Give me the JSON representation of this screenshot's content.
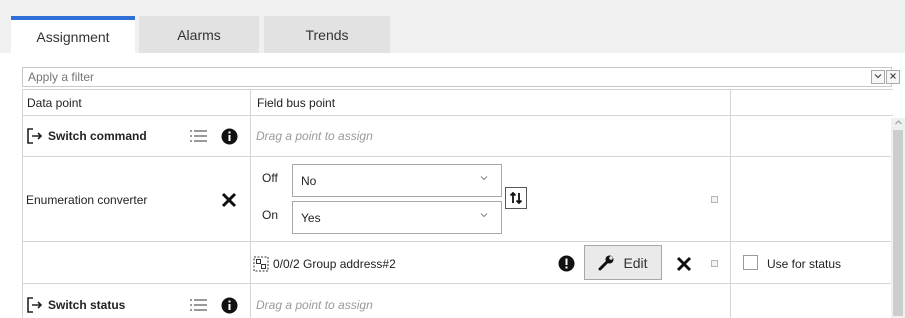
{
  "tabs": [
    {
      "label": "Assignment",
      "active": true
    },
    {
      "label": "Alarms",
      "active": false
    },
    {
      "label": "Trends",
      "active": false
    }
  ],
  "filter": {
    "placeholder": "Apply a filter"
  },
  "table": {
    "headers": {
      "data_point": "Data point",
      "field_bus_point": "Field bus point",
      "extra": ""
    },
    "rows": {
      "switch_command": {
        "label": "Switch command",
        "assign_hint": "Drag a point to assign"
      },
      "enumeration_converter": {
        "label": "Enumeration converter",
        "off_label": "Off",
        "off_value": "No",
        "on_label": "On",
        "on_value": "Yes"
      },
      "group_address": {
        "label": "0/0/2 Group address#2",
        "edit_label": "Edit",
        "use_for_status_label": "Use for status",
        "use_for_status_checked": false
      },
      "switch_status": {
        "label": "Switch status",
        "assign_hint": "Drag a point to assign"
      }
    }
  },
  "icons": {
    "export": "arrow-out-of-box-icon",
    "list": "list-icon",
    "info": "info-icon",
    "close": "close-icon",
    "swap": "swap-arrows-icon",
    "warning": "warning-icon",
    "wrench": "wrench-icon",
    "group_address": "group-address-icon"
  },
  "colors": {
    "accent": "#2f6fd6",
    "tab_inactive": "#e2e2e2"
  }
}
